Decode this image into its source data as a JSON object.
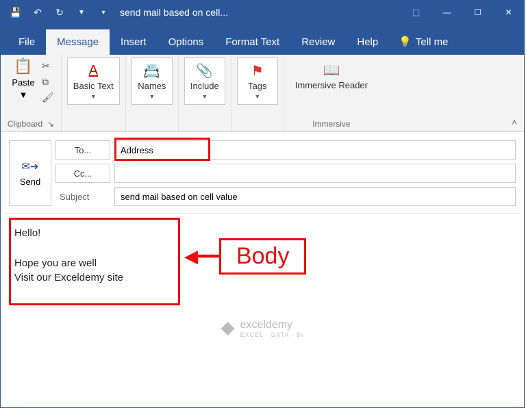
{
  "titlebar": {
    "title": "send mail based on cell..."
  },
  "tabs": {
    "file": "File",
    "message": "Message",
    "insert": "Insert",
    "options": "Options",
    "format": "Format Text",
    "review": "Review",
    "help": "Help",
    "tellme": "Tell me"
  },
  "ribbon": {
    "paste": "Paste",
    "clipboard_group": "Clipboard",
    "basic_text": "Basic Text",
    "names": "Names",
    "include": "Include",
    "tags": "Tags",
    "immersive_reader": "Immersive Reader",
    "immersive_group": "Immersive"
  },
  "compose": {
    "send": "Send",
    "to": "To...",
    "cc": "Cc...",
    "subject_label": "Subject",
    "to_value": "Address",
    "cc_value": "",
    "subject_value": "send mail based on cell value"
  },
  "body": {
    "line1": "Hello!",
    "line2": "Hope you are well",
    "line3": "Visit our Exceldemy site"
  },
  "annotations": {
    "body_label": "Body"
  },
  "watermark": {
    "name": "exceldemy",
    "sub": "EXCEL · DATA · BI"
  }
}
